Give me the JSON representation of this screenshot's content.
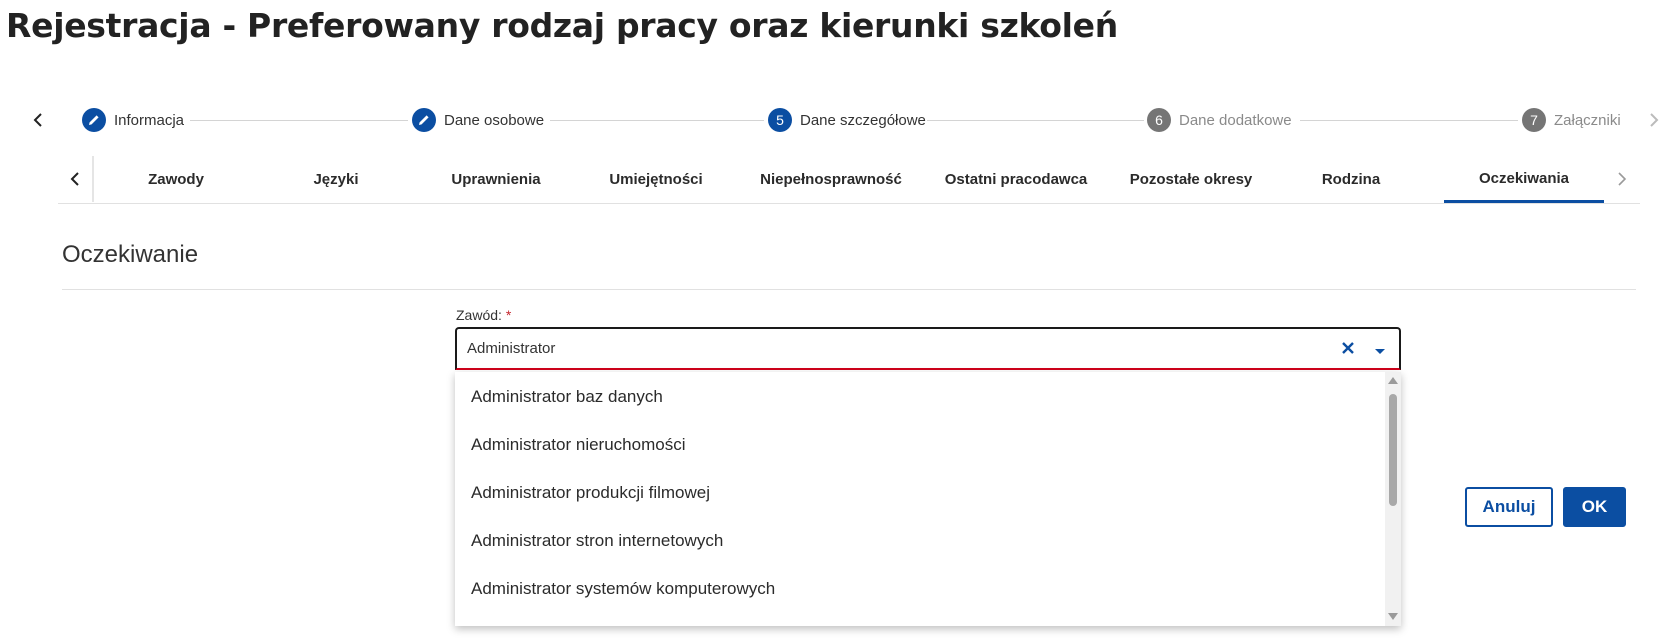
{
  "page": {
    "title": "Rejestracja - Preferowany rodzaj pracy oraz kierunki szkoleń"
  },
  "stepper": {
    "steps": [
      {
        "label": "Informacja",
        "marker": "pencil-icon",
        "state": "done"
      },
      {
        "label": "Dane osobowe",
        "marker": "pencil-icon",
        "state": "done"
      },
      {
        "number": "5",
        "label": "Dane szczegółowe",
        "state": "active"
      },
      {
        "number": "6",
        "label": "Dane dodatkowe",
        "state": "future"
      },
      {
        "number": "7",
        "label": "Załączniki",
        "state": "future"
      }
    ],
    "prev_icon": "chevron-left-icon",
    "next_icon": "chevron-right-icon"
  },
  "tabs": {
    "items": [
      {
        "label": "Zawody"
      },
      {
        "label": "Języki"
      },
      {
        "label": "Uprawnienia"
      },
      {
        "label": "Umiejętności"
      },
      {
        "label": "Niepełnosprawność"
      },
      {
        "label": "Ostatni pracodawca"
      },
      {
        "label": "Pozostałe okresy"
      },
      {
        "label": "Rodzina"
      },
      {
        "label": "Oczekiwania",
        "active": true
      }
    ]
  },
  "section": {
    "title": "Oczekiwanie"
  },
  "form": {
    "zawod": {
      "label": "Zawód:",
      "required_mark": "*",
      "value": "Administrator",
      "options": [
        "Administrator baz danych",
        "Administrator nieruchomości",
        "Administrator produkcji filmowej",
        "Administrator stron internetowych",
        "Administrator systemów komputerowych"
      ]
    }
  },
  "actions": {
    "cancel_label": "Anuluj",
    "ok_label": "OK"
  },
  "colors": {
    "primary": "#0b4ea2",
    "error": "#d0021b",
    "step_future": "#757575"
  }
}
